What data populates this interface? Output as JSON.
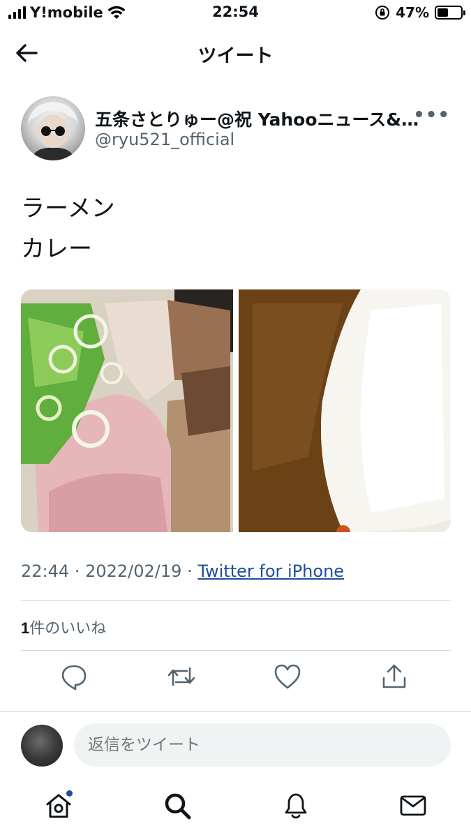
{
  "status_bar": {
    "carrier": "Y!mobile",
    "time": "22:54",
    "battery_percent": "47%",
    "battery_level": 0.47
  },
  "header": {
    "title": "ツイート"
  },
  "tweet": {
    "author": {
      "name": "五条さとりゅー@祝 Yahooニュース&…",
      "handle": "@ryu521_official"
    },
    "text_lines": [
      "ラーメン",
      "カレー"
    ],
    "media": [
      {
        "icon": "photo-ramen"
      },
      {
        "icon": "photo-curry"
      }
    ],
    "time": "22:44",
    "date": "2022/02/19",
    "separator": "·",
    "source": "Twitter for iPhone",
    "likes": {
      "count": "1",
      "label": "件のいいね"
    },
    "actions": [
      {
        "icon": "reply-icon"
      },
      {
        "icon": "retweet-icon"
      },
      {
        "icon": "like-icon"
      },
      {
        "icon": "share-icon"
      }
    ]
  },
  "reply": {
    "placeholder": "返信をツイート"
  },
  "tab_bar": {
    "items": [
      {
        "icon": "home-icon",
        "has_notification_dot": true
      },
      {
        "icon": "search-icon"
      },
      {
        "icon": "notifications-icon"
      },
      {
        "icon": "messages-icon"
      }
    ]
  },
  "colors": {
    "link": "#1d4ea0",
    "secondary_text": "#536471",
    "divider": "#cfd9de"
  }
}
